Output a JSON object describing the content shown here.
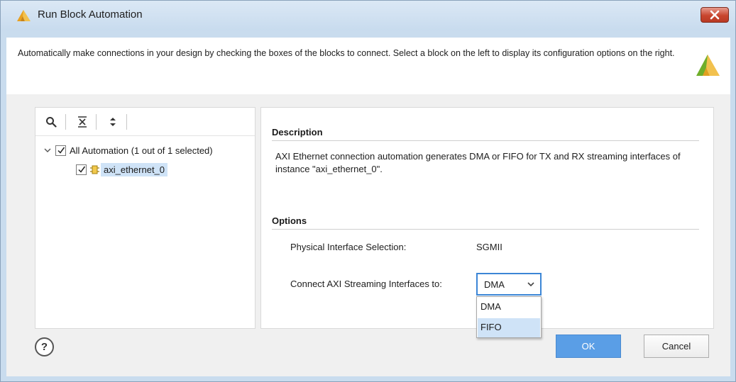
{
  "window": {
    "title": "Run Block Automation",
    "close_label": "×"
  },
  "info": {
    "text": "Automatically make connections in your design by checking the boxes of the blocks to connect. Select a block on the left to display its configuration options on the right."
  },
  "tree": {
    "toolbar_icons": [
      "search-icon",
      "collapse-all-icon",
      "expand-all-icon"
    ],
    "root": {
      "label": "All Automation (1 out of 1 selected)",
      "checked": true,
      "expanded": true
    },
    "children": [
      {
        "label": "axi_ethernet_0",
        "checked": true,
        "icon": "ip-block-icon",
        "selected": true
      }
    ]
  },
  "description": {
    "heading": "Description",
    "text": "AXI Ethernet connection automation generates DMA or FIFO for TX and RX streaming interfaces of instance \"axi_ethernet_0\"."
  },
  "options": {
    "heading": "Options",
    "physical_interface_label": "Physical Interface Selection:",
    "physical_interface_value": "SGMII",
    "connect_label": "Connect AXI Streaming Interfaces to:",
    "connect_value": "DMA",
    "connect_options": [
      "DMA",
      "FIFO"
    ],
    "highlighted_option": "FIFO"
  },
  "footer": {
    "help_label": "?",
    "ok_label": "OK",
    "cancel_label": "Cancel"
  },
  "colors": {
    "accent": "#5a9ee6",
    "selection": "#cfe3f7",
    "close_button": "#c8452e"
  }
}
